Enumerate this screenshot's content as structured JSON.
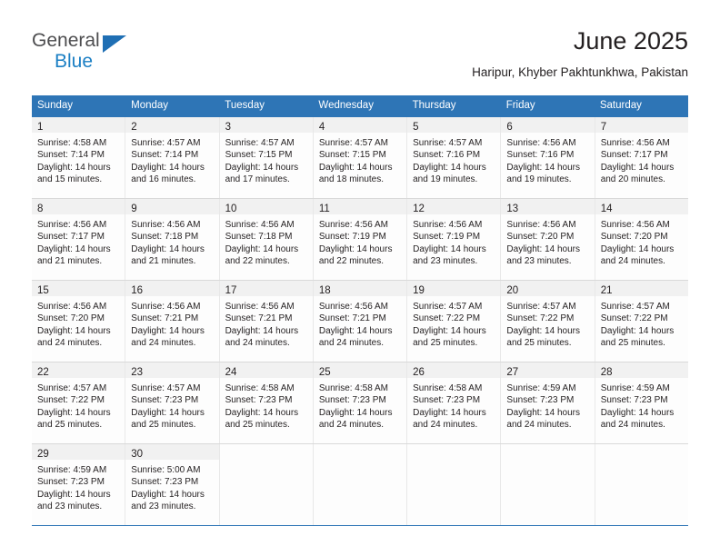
{
  "brand": {
    "name_part1": "General",
    "name_part2": "Blue",
    "triangle_color": "#1f6fb4",
    "blue_color": "#1b7fc4"
  },
  "header": {
    "title": "June 2025",
    "subtitle": "Haripur, Khyber Pakhtunkhwa, Pakistan"
  },
  "theme": {
    "header_bg": "#2e75b6",
    "daynum_bg": "#f1f1f1",
    "cell_bg": "#fdfdfd",
    "row_border": "#d9d9d9"
  },
  "weekdays": [
    "Sunday",
    "Monday",
    "Tuesday",
    "Wednesday",
    "Thursday",
    "Friday",
    "Saturday"
  ],
  "weeks": [
    [
      {
        "day": "1",
        "sunrise": "Sunrise: 4:58 AM",
        "sunset": "Sunset: 7:14 PM",
        "daylight1": "Daylight: 14 hours",
        "daylight2": "and 15 minutes."
      },
      {
        "day": "2",
        "sunrise": "Sunrise: 4:57 AM",
        "sunset": "Sunset: 7:14 PM",
        "daylight1": "Daylight: 14 hours",
        "daylight2": "and 16 minutes."
      },
      {
        "day": "3",
        "sunrise": "Sunrise: 4:57 AM",
        "sunset": "Sunset: 7:15 PM",
        "daylight1": "Daylight: 14 hours",
        "daylight2": "and 17 minutes."
      },
      {
        "day": "4",
        "sunrise": "Sunrise: 4:57 AM",
        "sunset": "Sunset: 7:15 PM",
        "daylight1": "Daylight: 14 hours",
        "daylight2": "and 18 minutes."
      },
      {
        "day": "5",
        "sunrise": "Sunrise: 4:57 AM",
        "sunset": "Sunset: 7:16 PM",
        "daylight1": "Daylight: 14 hours",
        "daylight2": "and 19 minutes."
      },
      {
        "day": "6",
        "sunrise": "Sunrise: 4:56 AM",
        "sunset": "Sunset: 7:16 PM",
        "daylight1": "Daylight: 14 hours",
        "daylight2": "and 19 minutes."
      },
      {
        "day": "7",
        "sunrise": "Sunrise: 4:56 AM",
        "sunset": "Sunset: 7:17 PM",
        "daylight1": "Daylight: 14 hours",
        "daylight2": "and 20 minutes."
      }
    ],
    [
      {
        "day": "8",
        "sunrise": "Sunrise: 4:56 AM",
        "sunset": "Sunset: 7:17 PM",
        "daylight1": "Daylight: 14 hours",
        "daylight2": "and 21 minutes."
      },
      {
        "day": "9",
        "sunrise": "Sunrise: 4:56 AM",
        "sunset": "Sunset: 7:18 PM",
        "daylight1": "Daylight: 14 hours",
        "daylight2": "and 21 minutes."
      },
      {
        "day": "10",
        "sunrise": "Sunrise: 4:56 AM",
        "sunset": "Sunset: 7:18 PM",
        "daylight1": "Daylight: 14 hours",
        "daylight2": "and 22 minutes."
      },
      {
        "day": "11",
        "sunrise": "Sunrise: 4:56 AM",
        "sunset": "Sunset: 7:19 PM",
        "daylight1": "Daylight: 14 hours",
        "daylight2": "and 22 minutes."
      },
      {
        "day": "12",
        "sunrise": "Sunrise: 4:56 AM",
        "sunset": "Sunset: 7:19 PM",
        "daylight1": "Daylight: 14 hours",
        "daylight2": "and 23 minutes."
      },
      {
        "day": "13",
        "sunrise": "Sunrise: 4:56 AM",
        "sunset": "Sunset: 7:20 PM",
        "daylight1": "Daylight: 14 hours",
        "daylight2": "and 23 minutes."
      },
      {
        "day": "14",
        "sunrise": "Sunrise: 4:56 AM",
        "sunset": "Sunset: 7:20 PM",
        "daylight1": "Daylight: 14 hours",
        "daylight2": "and 24 minutes."
      }
    ],
    [
      {
        "day": "15",
        "sunrise": "Sunrise: 4:56 AM",
        "sunset": "Sunset: 7:20 PM",
        "daylight1": "Daylight: 14 hours",
        "daylight2": "and 24 minutes."
      },
      {
        "day": "16",
        "sunrise": "Sunrise: 4:56 AM",
        "sunset": "Sunset: 7:21 PM",
        "daylight1": "Daylight: 14 hours",
        "daylight2": "and 24 minutes."
      },
      {
        "day": "17",
        "sunrise": "Sunrise: 4:56 AM",
        "sunset": "Sunset: 7:21 PM",
        "daylight1": "Daylight: 14 hours",
        "daylight2": "and 24 minutes."
      },
      {
        "day": "18",
        "sunrise": "Sunrise: 4:56 AM",
        "sunset": "Sunset: 7:21 PM",
        "daylight1": "Daylight: 14 hours",
        "daylight2": "and 24 minutes."
      },
      {
        "day": "19",
        "sunrise": "Sunrise: 4:57 AM",
        "sunset": "Sunset: 7:22 PM",
        "daylight1": "Daylight: 14 hours",
        "daylight2": "and 25 minutes."
      },
      {
        "day": "20",
        "sunrise": "Sunrise: 4:57 AM",
        "sunset": "Sunset: 7:22 PM",
        "daylight1": "Daylight: 14 hours",
        "daylight2": "and 25 minutes."
      },
      {
        "day": "21",
        "sunrise": "Sunrise: 4:57 AM",
        "sunset": "Sunset: 7:22 PM",
        "daylight1": "Daylight: 14 hours",
        "daylight2": "and 25 minutes."
      }
    ],
    [
      {
        "day": "22",
        "sunrise": "Sunrise: 4:57 AM",
        "sunset": "Sunset: 7:22 PM",
        "daylight1": "Daylight: 14 hours",
        "daylight2": "and 25 minutes."
      },
      {
        "day": "23",
        "sunrise": "Sunrise: 4:57 AM",
        "sunset": "Sunset: 7:23 PM",
        "daylight1": "Daylight: 14 hours",
        "daylight2": "and 25 minutes."
      },
      {
        "day": "24",
        "sunrise": "Sunrise: 4:58 AM",
        "sunset": "Sunset: 7:23 PM",
        "daylight1": "Daylight: 14 hours",
        "daylight2": "and 25 minutes."
      },
      {
        "day": "25",
        "sunrise": "Sunrise: 4:58 AM",
        "sunset": "Sunset: 7:23 PM",
        "daylight1": "Daylight: 14 hours",
        "daylight2": "and 24 minutes."
      },
      {
        "day": "26",
        "sunrise": "Sunrise: 4:58 AM",
        "sunset": "Sunset: 7:23 PM",
        "daylight1": "Daylight: 14 hours",
        "daylight2": "and 24 minutes."
      },
      {
        "day": "27",
        "sunrise": "Sunrise: 4:59 AM",
        "sunset": "Sunset: 7:23 PM",
        "daylight1": "Daylight: 14 hours",
        "daylight2": "and 24 minutes."
      },
      {
        "day": "28",
        "sunrise": "Sunrise: 4:59 AM",
        "sunset": "Sunset: 7:23 PM",
        "daylight1": "Daylight: 14 hours",
        "daylight2": "and 24 minutes."
      }
    ],
    [
      {
        "day": "29",
        "sunrise": "Sunrise: 4:59 AM",
        "sunset": "Sunset: 7:23 PM",
        "daylight1": "Daylight: 14 hours",
        "daylight2": "and 23 minutes."
      },
      {
        "day": "30",
        "sunrise": "Sunrise: 5:00 AM",
        "sunset": "Sunset: 7:23 PM",
        "daylight1": "Daylight: 14 hours",
        "daylight2": "and 23 minutes."
      },
      {
        "day": "",
        "sunrise": "",
        "sunset": "",
        "daylight1": "",
        "daylight2": ""
      },
      {
        "day": "",
        "sunrise": "",
        "sunset": "",
        "daylight1": "",
        "daylight2": ""
      },
      {
        "day": "",
        "sunrise": "",
        "sunset": "",
        "daylight1": "",
        "daylight2": ""
      },
      {
        "day": "",
        "sunrise": "",
        "sunset": "",
        "daylight1": "",
        "daylight2": ""
      },
      {
        "day": "",
        "sunrise": "",
        "sunset": "",
        "daylight1": "",
        "daylight2": ""
      }
    ]
  ]
}
